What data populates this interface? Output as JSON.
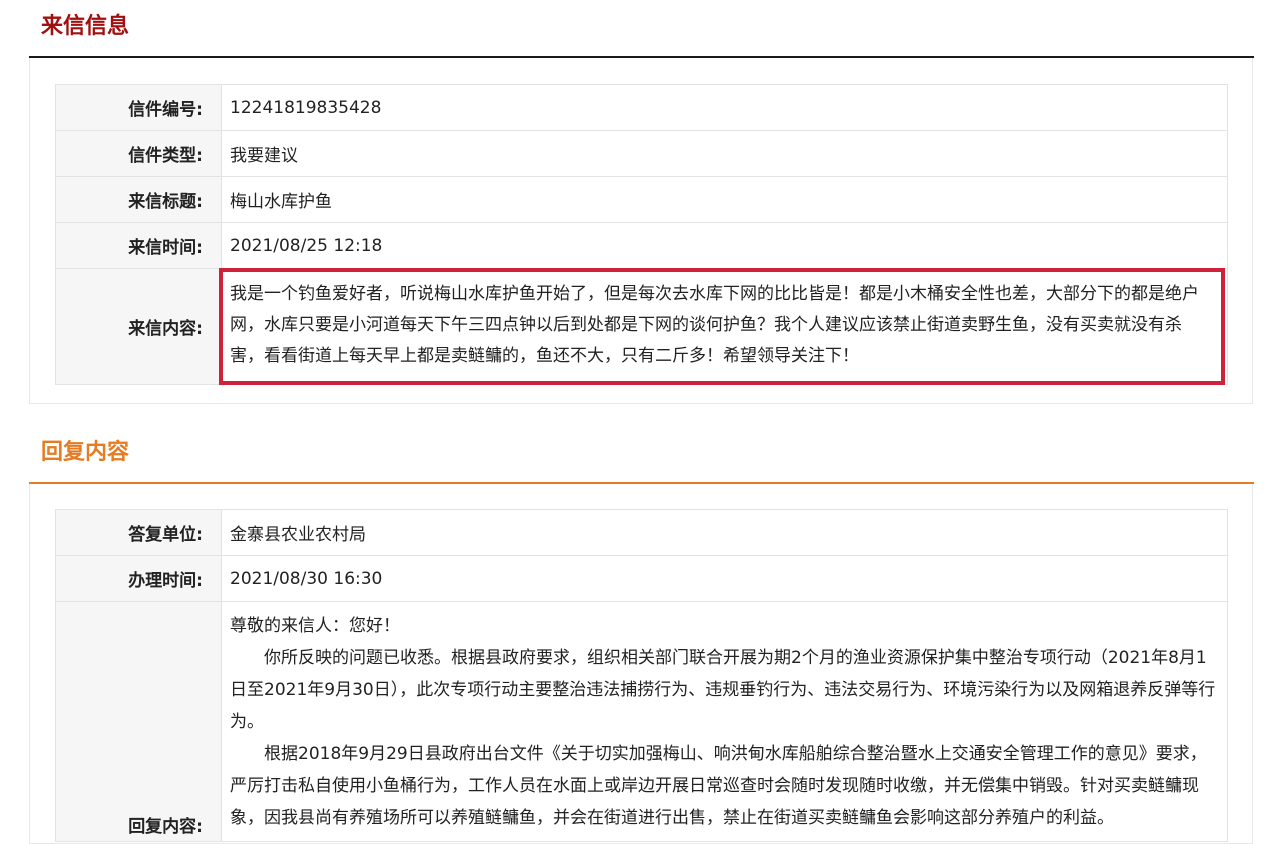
{
  "letter_section": {
    "title": "来信信息",
    "rows": [
      {
        "label": "信件编号:",
        "value": "12241819835428"
      },
      {
        "label": "信件类型:",
        "value": "我要建议"
      },
      {
        "label": "来信标题:",
        "value": "梅山水库护鱼"
      },
      {
        "label": "来信时间:",
        "value": "2021/08/25 12:18"
      }
    ],
    "content_label": "来信内容:",
    "content": "我是一个钓鱼爱好者，听说梅山水库护鱼开始了，但是每次去水库下网的比比皆是！都是小木桶安全性也差，大部分下的都是绝户网，水库只要是小河道每天下午三四点钟以后到处都是下网的谈何护鱼？我个人建议应该禁止街道卖野生鱼，没有买卖就没有杀害，看看街道上每天早上都是卖鲢鳙的，鱼还不大，只有二斤多！希望领导关注下！"
  },
  "reply_section": {
    "title": "回复内容",
    "rows": [
      {
        "label": "答复单位:",
        "value": "金寨县农业农村局"
      },
      {
        "label": "办理时间:",
        "value": "2021/08/30 16:30"
      }
    ],
    "content_label": "回复内容:",
    "greeting": "尊敬的来信人：您好！",
    "paragraphs": [
      "你所反映的问题已收悉。根据县政府要求，组织相关部门联合开展为期2个月的渔业资源保护集中整治专项行动（2021年8月1日至2021年9月30日），此次专项行动主要整治违法捕捞行为、违规垂钓行为、违法交易行为、环境污染行为以及网箱退养反弹等行为。",
      "根据2018年9月29日县政府出台文件《关于切实加强梅山、响洪甸水库船舶综合整治暨水上交通安全管理工作的意见》要求，严厉打击私自使用小鱼桶行为，工作人员在水面上或岸边开展日常巡查时会随时发现随时收缴，并无偿集中销毁。针对买卖鲢鳙现象，因我县尚有养殖场所可以养殖鲢鳙鱼，并会在街道进行出售，禁止在街道买卖鲢鳙鱼会影响这部分养殖户的利益。"
    ]
  },
  "colors": {
    "letter_title": "#a01010",
    "reply_title": "#e57b22",
    "highlight_border": "#d0213a"
  }
}
